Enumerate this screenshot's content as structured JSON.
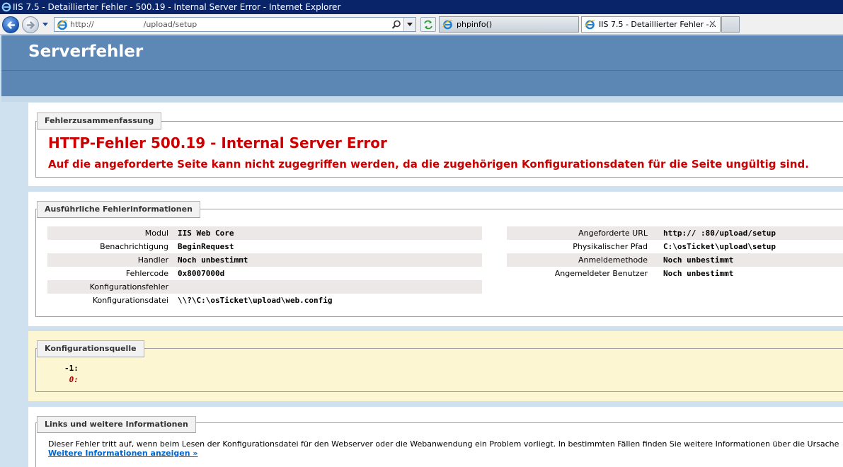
{
  "window": {
    "title": "IIS 7.5 - Detaillierter Fehler - 500.19 - Internal Server Error - Internet Explorer"
  },
  "browser": {
    "address": "http://                    /upload/setup",
    "tabs": [
      {
        "label": "phpinfo()",
        "active": false
      },
      {
        "label": "IIS 7.5 - Detaillierter Fehler -...",
        "active": true
      }
    ],
    "tab_close_glyph": "✕"
  },
  "page": {
    "header_title": "Serverfehler",
    "summary": {
      "legend": "Fehlerzusammenfassung",
      "title": "HTTP-Fehler 500.19 - Internal Server Error",
      "description": "Auf die angeforderte Seite kann nicht zugegriffen werden, da die zugehörigen Konfigurationsdaten für die Seite ungültig sind."
    },
    "details": {
      "legend": "Ausführliche Fehlerinformationen",
      "left": [
        {
          "key": "Modul",
          "value": "IIS Web Core"
        },
        {
          "key": "Benachrichtigung",
          "value": "BeginRequest"
        },
        {
          "key": "Handler",
          "value": "Noch unbestimmt"
        },
        {
          "key": "Fehlercode",
          "value": "0x8007000d"
        },
        {
          "key": "Konfigurationsfehler",
          "value": ""
        },
        {
          "key": "Konfigurationsdatei",
          "value": "\\\\?\\C:\\osTicket\\upload\\web.config"
        }
      ],
      "right": [
        {
          "key": "Angeforderte URL",
          "value": "http://                  :80/upload/setup"
        },
        {
          "key": "Physikalischer Pfad",
          "value": "C:\\osTicket\\upload\\setup"
        },
        {
          "key": "Anmeldemethode",
          "value": "Noch unbestimmt"
        },
        {
          "key": "Angemeldeter Benutzer",
          "value": "Noch unbestimmt"
        }
      ]
    },
    "config_source": {
      "legend": "Konfigurationsquelle",
      "lines": [
        "-1:",
        " 0:"
      ]
    },
    "links": {
      "legend": "Links und weitere Informationen",
      "text": "Dieser Fehler tritt auf, wenn beim Lesen der Konfigurationsdatei für den Webserver oder die Webanwendung ein Problem vorliegt. In bestimmten Fällen finden Sie weitere Informationen über die Ursache",
      "more_link": "Weitere Informationen anzeigen »"
    }
  },
  "colors": {
    "header_blue": "#5d88b6",
    "error_red": "#cc0000",
    "link_blue": "#0066cc",
    "config_yellow": "#fdf6d3"
  },
  "icons": [
    "ie-icon",
    "back-arrow-icon",
    "forward-arrow-icon",
    "search-icon",
    "refresh-icon",
    "close-icon"
  ]
}
